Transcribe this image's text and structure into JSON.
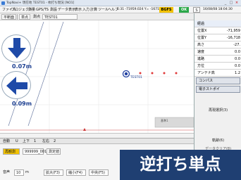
{
  "window": {
    "title": "TopNavi+  現在地 TEST01 - 杭打ち現況 [NO1]",
    "btn_min": "_",
    "btn_max": "□",
    "btn_close": "×"
  },
  "menu": {
    "items": [
      "ファイル",
      "プロジェクト",
      "測量",
      "GPS/TS",
      "測設",
      "データ表示",
      "表示",
      "入力",
      "計算",
      "ツール",
      "ヘルプ"
    ],
    "coord": "1:31   -71959.024 Y=  -16718.608",
    "badge_fix": "BGFS",
    "badge_ok": "OK",
    "clock": "16/08/08 18:04:30",
    "colors": {
      "fix": "#f2c200",
      "ok": "#2aa84a"
    }
  },
  "toolbar": {
    "mode": "平断面",
    "point_btn": "単点",
    "name_label": "測点",
    "point_name": "TEST01"
  },
  "canvas": {
    "north_distance": "0.07m",
    "west_distance": "0.09m",
    "target_label": "TEST01",
    "base_line_label": "基準1"
  },
  "right_panel": {
    "header": "経過",
    "rows": [
      {
        "k": "位置X",
        "v": "-71,959"
      },
      {
        "k": "位置Y",
        "v": "-16,718"
      },
      {
        "k": "高さ",
        "v": "-27."
      },
      {
        "k": "速度",
        "v": "0.0"
      },
      {
        "k": "進路",
        "v": "0.0"
      },
      {
        "k": "方位",
        "v": "0.0"
      },
      {
        "k": "アンテナ高",
        "v": "1.2"
      }
    ],
    "tab_compass": "コンパス",
    "tab_other": "電子ストポイ",
    "btn_history": "再現選択(3)",
    "btn_track": "軌跡(6)",
    "btn_data": "データクリア(8)"
  },
  "bottom": {
    "tabs": [
      "自動",
      "U",
      "上下",
      "1",
      "左右",
      "2"
    ],
    "btn_record": "再観測",
    "input_name": "999999_001",
    "btn_measure": "測定値",
    "row3": {
      "label1": "音声",
      "value1": "10",
      "unit1": "m",
      "btn_zoom_in": "拡大(F3)",
      "btn_zoom_out": "縮小(F4)",
      "btn_center": "中央(F5)"
    }
  },
  "banner": {
    "text": "逆打ち単点"
  }
}
